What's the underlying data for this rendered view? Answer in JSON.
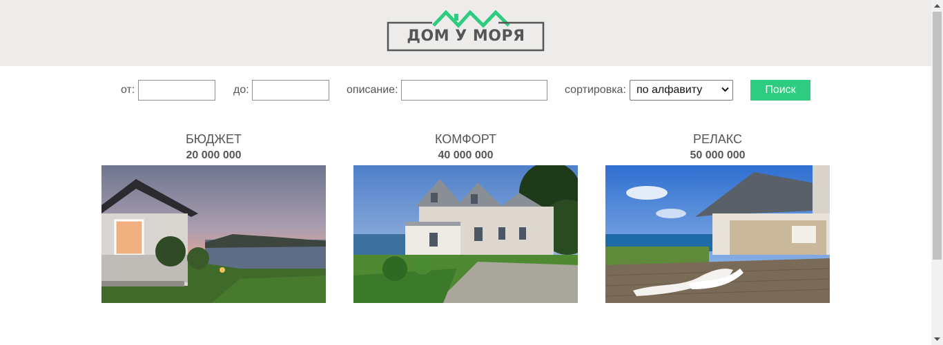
{
  "header": {
    "logo_text": "ДОМ У МОРЯ"
  },
  "search": {
    "from_label": "от:",
    "from_value": "",
    "to_label": "до:",
    "to_value": "",
    "description_label": "описание:",
    "description_value": "",
    "sort_label": "сортировка:",
    "sort_selected": "по алфавиту",
    "search_button": "Поиск"
  },
  "cards": [
    {
      "title": "БЮДЖЕТ",
      "price": "20 000 000"
    },
    {
      "title": "КОМФОРТ",
      "price": "40 000 000"
    },
    {
      "title": "РЕЛАКС",
      "price": "50 000 000"
    }
  ],
  "colors": {
    "accent": "#2ecc80",
    "header_bg": "#edecea",
    "text": "#555555"
  }
}
